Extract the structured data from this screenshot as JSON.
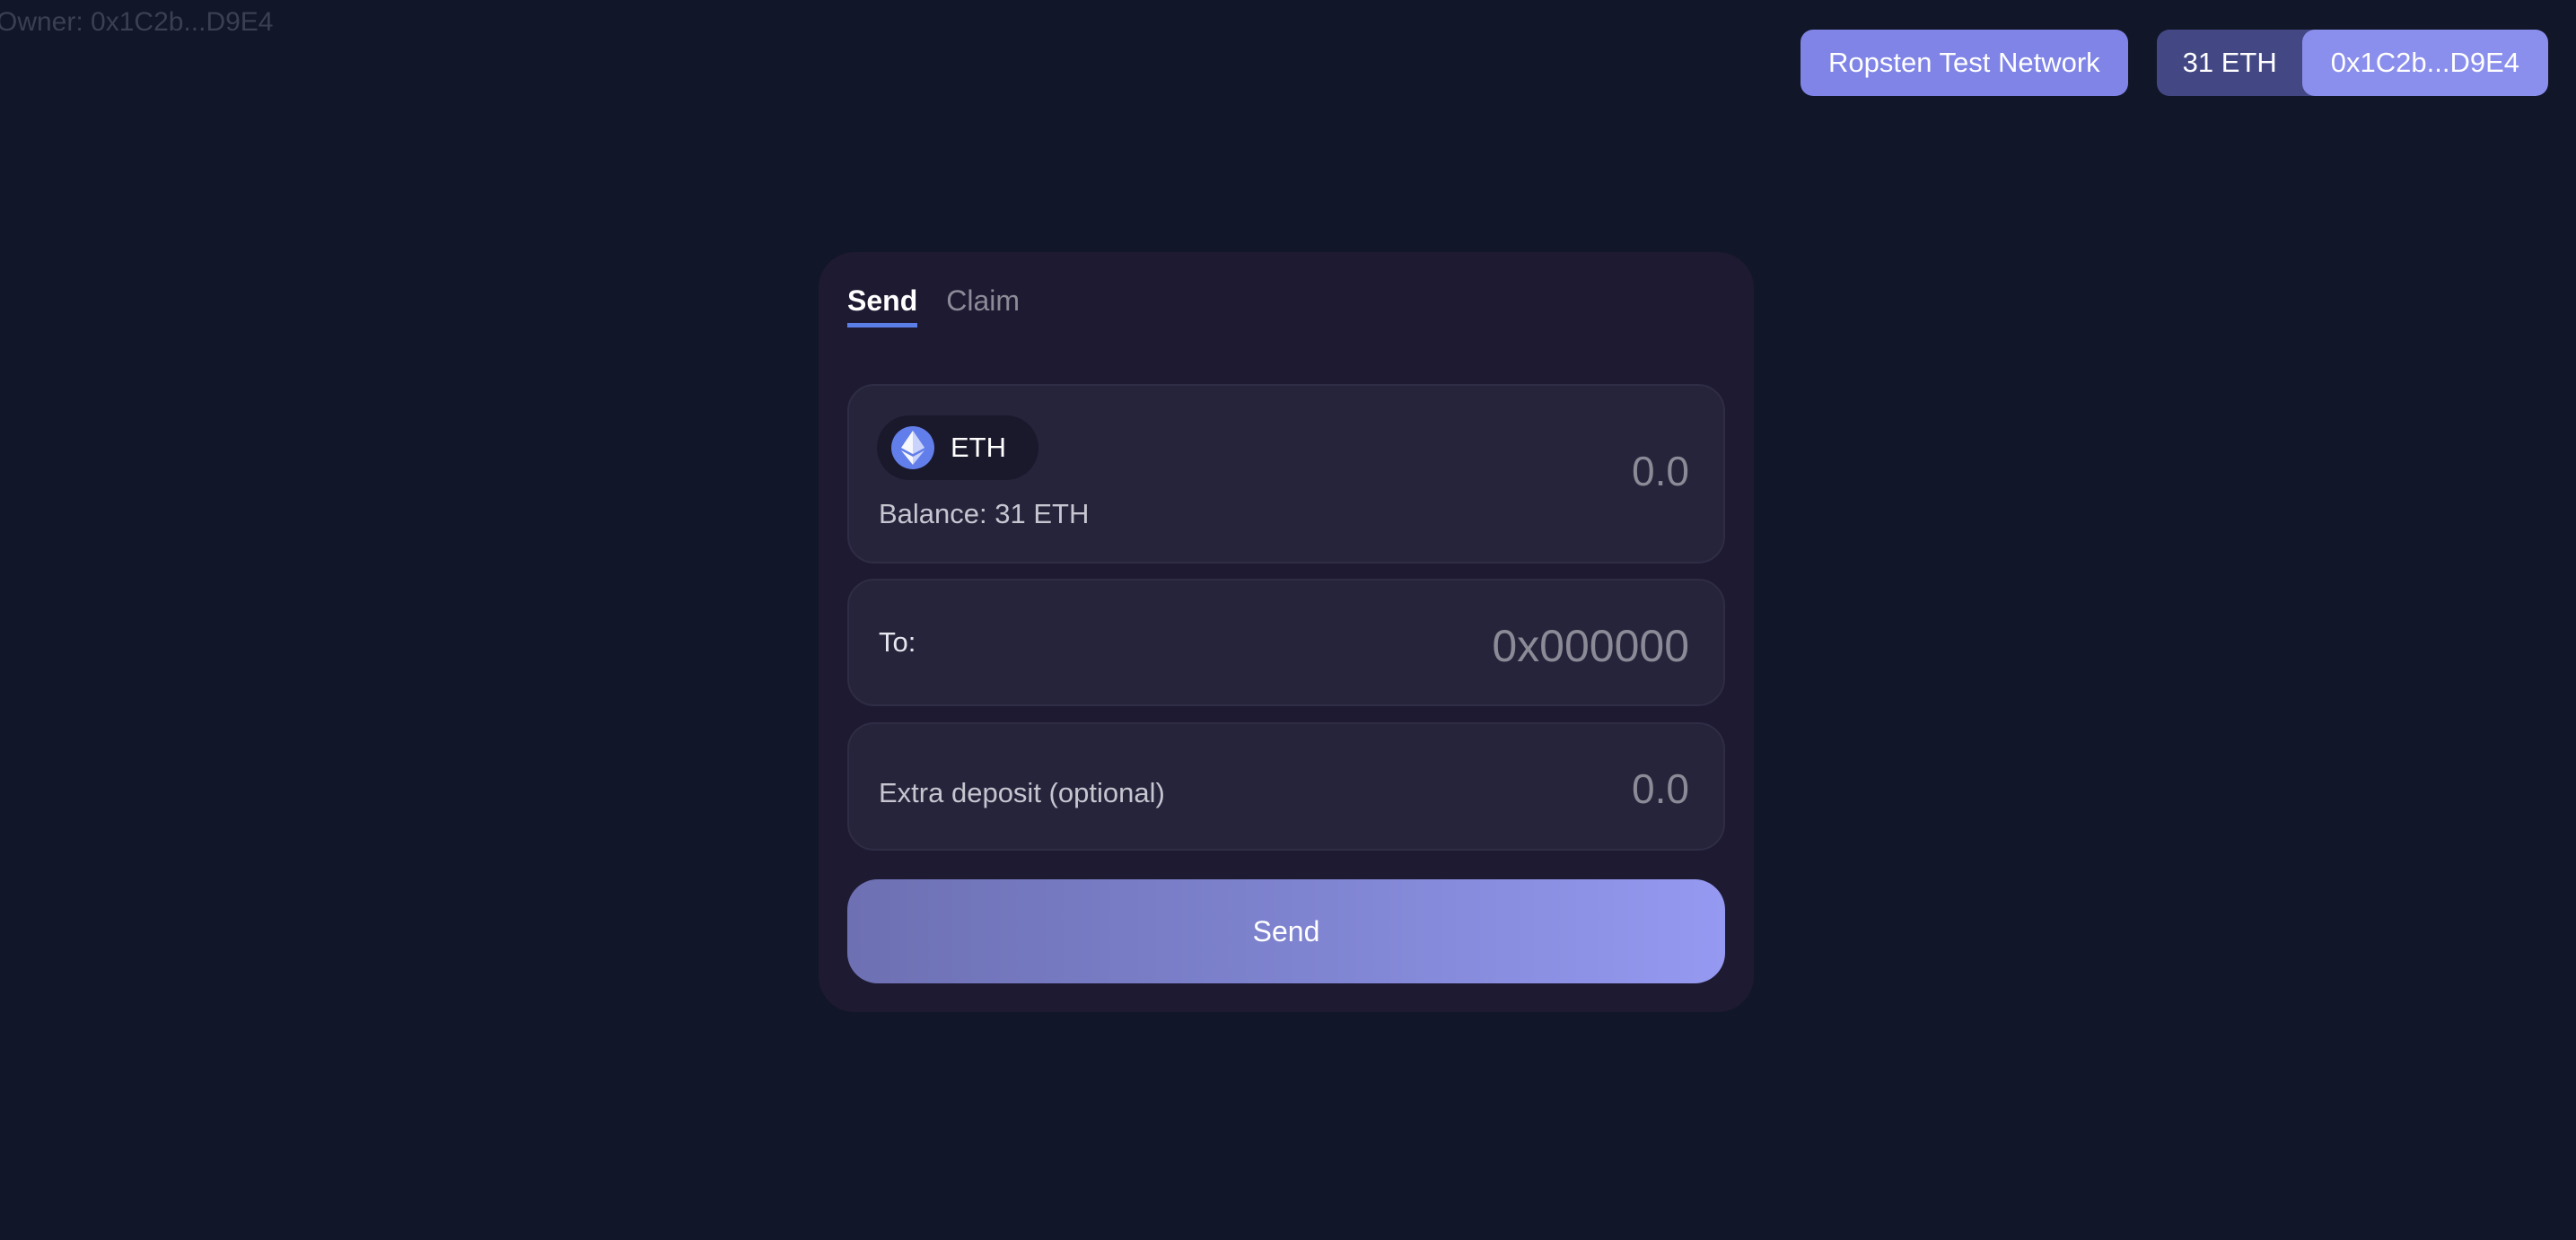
{
  "owner_label": "Owner: 0x1C2b...D9E4",
  "header": {
    "network_label": "Ropsten Test Network",
    "balance_label": "31 ETH",
    "address_label": "0x1C2b...D9E4"
  },
  "card": {
    "tabs": [
      {
        "label": "Send",
        "active": true
      },
      {
        "label": "Claim",
        "active": false
      }
    ],
    "amount_panel": {
      "token_label": "ETH",
      "token_icon": "ethereum-icon",
      "balance_text": "Balance: 31 ETH",
      "placeholder": "0.0"
    },
    "to_panel": {
      "label": "To:",
      "placeholder": "0x000000"
    },
    "extra_panel": {
      "label": "Extra deposit (optional)",
      "placeholder": "0.0"
    },
    "send_button_label": "Send"
  },
  "colors": {
    "background": "#111628",
    "card": "#1e1a32",
    "panel": "#25243b",
    "accent": "#7f84e6",
    "tab_underline": "#5b7fe6",
    "eth_icon": "#627eea"
  }
}
